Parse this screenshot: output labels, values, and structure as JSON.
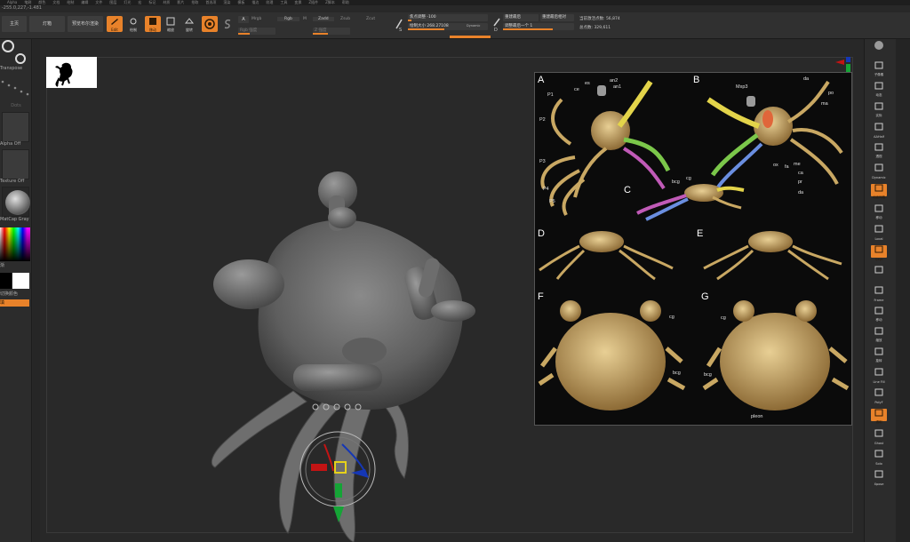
{
  "menubar": {
    "items": [
      "Alpha",
      "笔刷",
      "颜色",
      "文档",
      "绘制",
      "编辑",
      "文件",
      "图层",
      "灯光",
      "宏",
      "标记",
      "材质",
      "影片",
      "拾取",
      "首选项",
      "渲染",
      "模板",
      "描边",
      "纹理",
      "工具",
      "变换",
      "Z插件",
      "Z脚本",
      "帮助"
    ]
  },
  "coords": "-255.0,227,-1.481",
  "toolbar": {
    "home_tab": "主页",
    "lightbox_tab": "灯箱",
    "preview_render": "预览布尔渲染",
    "edit_label": "Edit",
    "draw_label": "绘制",
    "move_label": "移动",
    "scale_label": "缩放",
    "rotate_label": "旋转",
    "mrgb_label": "Mrgb",
    "rgb_label": "Rgb",
    "m_label": "M",
    "zadd_label": "Zadd",
    "zsub_label": "Zsub",
    "zcut_label": "Zcut",
    "rgb_intensity_label": "Rgb 强度",
    "z_intensity_label": "Z 强度",
    "focal_shift_label": "焦点调整 -100",
    "draw_size_label": "绘制大小 268.27108",
    "dynamic_label": "Dynamic",
    "s_label": "S",
    "d_label": "D",
    "active_points_label": "当前激活点数: 56,874",
    "total_points_label": "总点数: 329,611",
    "restore_label": "重建最后",
    "restore_relative_label": "重建最后相对",
    "adjust_last_label": "调整最后一个 1"
  },
  "leftpanel": {
    "transpose_label": "Transpose",
    "dots_label": "Dots",
    "alpha_label": "Alpha Off",
    "texture_label": "Texture Off",
    "matcap_label": "MatCap Gray",
    "gradient_label": "渐",
    "switch_color_label": "切换颜色",
    "fill_label": "填"
  },
  "figure": {
    "panel_labels": [
      "A",
      "B",
      "C",
      "D",
      "E",
      "F",
      "G"
    ],
    "annotations": {
      "A": [
        "es",
        "an2",
        "an1",
        "ce",
        "P1",
        "P2",
        "P3",
        "P4",
        "P5"
      ],
      "B": [
        "Mxp3",
        "da",
        "po",
        "ma",
        "ox",
        "fa",
        "me",
        "ca",
        "pr",
        "da"
      ],
      "C": [
        "bcg",
        "cg"
      ],
      "F": [
        "cg",
        "bcg"
      ],
      "G": [
        "cg",
        "bcg",
        "pleon"
      ]
    }
  },
  "rightpanel": {
    "buttons": [
      {
        "label": "",
        "icon": "sphere-icon",
        "on": false
      },
      {
        "label": "子像素",
        "icon": "subpixel-icon",
        "on": false
      },
      {
        "label": "动态",
        "icon": "dynamic-icon",
        "on": false
      },
      {
        "label": "实际",
        "icon": "actual-icon",
        "on": false
      },
      {
        "label": "AAHalf",
        "icon": "aahalf-icon",
        "on": false
      },
      {
        "label": "透视",
        "icon": "persp-icon",
        "on": false
      },
      {
        "label": "Dynamic",
        "icon": "dynamic-floor-icon",
        "on": false
      },
      {
        "label": "地面网格",
        "icon": "floor-icon",
        "on": true
      },
      {
        "label": "移动",
        "icon": "move-icon",
        "on": false
      },
      {
        "label": "Local",
        "icon": "local-icon",
        "on": false
      },
      {
        "label": "Qxyz",
        "icon": "xyz-icon",
        "on": true
      },
      {
        "label": "",
        "icon": "rot-icon",
        "on": false
      },
      {
        "label": "Frame",
        "icon": "frame-icon",
        "on": false
      },
      {
        "label": "移动",
        "icon": "move2-icon",
        "on": false
      },
      {
        "label": "缩放",
        "icon": "scale-icon",
        "on": false
      },
      {
        "label": "旋转",
        "icon": "rotate-icon",
        "on": false
      },
      {
        "label": "Line Fill",
        "icon": "linefill-icon",
        "on": false
      },
      {
        "label": "PolyF",
        "icon": "polyf-icon",
        "on": false
      },
      {
        "label": "透明",
        "icon": "transp-icon",
        "on": true
      },
      {
        "label": "Ghost",
        "icon": "ghost-icon",
        "on": false
      },
      {
        "label": "Solo",
        "icon": "solo-icon",
        "on": false
      },
      {
        "label": "Xpose",
        "icon": "xpose-icon",
        "on": false
      }
    ]
  },
  "colors": {
    "accent": "#e8822a",
    "bg": "#282828",
    "panel": "#2c2c2c"
  }
}
